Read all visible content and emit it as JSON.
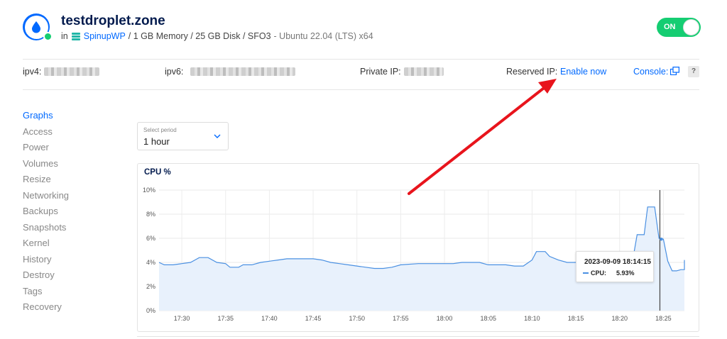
{
  "droplet": {
    "name": "testdroplet.zone",
    "subtitle_in": "in",
    "project": "SpinupWP",
    "specs": "/ 1 GB Memory / 25 GB Disk / SFO3",
    "image": "- Ubuntu 22.04 (LTS) x64",
    "power_toggle": "ON"
  },
  "ip_bar": {
    "ipv4_label": "ipv4:",
    "ipv6_label": "ipv6:",
    "private_label": "Private IP:",
    "reserved_label": "Reserved IP:",
    "reserved_link": "Enable now",
    "console_label": "Console:",
    "help": "?"
  },
  "sidebar": {
    "items": [
      {
        "label": "Graphs",
        "active": true
      },
      {
        "label": "Access"
      },
      {
        "label": "Power"
      },
      {
        "label": "Volumes"
      },
      {
        "label": "Resize"
      },
      {
        "label": "Networking"
      },
      {
        "label": "Backups"
      },
      {
        "label": "Snapshots"
      },
      {
        "label": "Kernel"
      },
      {
        "label": "History"
      },
      {
        "label": "Destroy"
      },
      {
        "label": "Tags"
      },
      {
        "label": "Recovery"
      }
    ]
  },
  "period": {
    "caption": "Select period",
    "value": "1 hour"
  },
  "colors": {
    "accent": "#0069ff",
    "on_green": "#15cd72",
    "series_line": "#4a90e2",
    "series_fill": "#e8f1fc",
    "annotation_arrow": "#e8141c"
  },
  "icons": {
    "droplet": "water-drop-icon",
    "project": "stack-icon",
    "console": "external-window-icon",
    "period": "chevron-down-icon"
  },
  "tooltip": {
    "date": "2023-09-09 18:14:15",
    "series": "CPU:",
    "value": "5.93%"
  },
  "chart_data": {
    "type": "area",
    "title": "CPU %",
    "ylim": [
      0,
      10
    ],
    "yticks": [
      "10%",
      "8%",
      "6%",
      "4%",
      "2%",
      "0%"
    ],
    "ytick_values": [
      10,
      8,
      6,
      4,
      2,
      0
    ],
    "xticks": [
      "17:30",
      "17:35",
      "17:40",
      "17:45",
      "17:50",
      "17:55",
      "18:00",
      "18:05",
      "18:10",
      "18:15",
      "18:20",
      "18:25"
    ],
    "xlim_minutes": [
      17.4,
      77.4
    ],
    "grid": true,
    "series": [
      {
        "values": [
          [
            17.4,
            4.0
          ],
          [
            18.0,
            3.8
          ],
          [
            19.0,
            3.8
          ],
          [
            20.0,
            3.9
          ],
          [
            21.0,
            4.0
          ],
          [
            21.5,
            4.2
          ],
          [
            22.0,
            4.4
          ],
          [
            23.0,
            4.4
          ],
          [
            24.0,
            4.0
          ],
          [
            25.0,
            3.9
          ],
          [
            25.5,
            3.6
          ],
          [
            26.5,
            3.6
          ],
          [
            27.0,
            3.8
          ],
          [
            28.0,
            3.8
          ],
          [
            29.0,
            4.0
          ],
          [
            30.0,
            4.1
          ],
          [
            31.0,
            4.2
          ],
          [
            32.0,
            4.3
          ],
          [
            35.0,
            4.3
          ],
          [
            36.0,
            4.2
          ],
          [
            37.0,
            4.0
          ],
          [
            38.0,
            3.9
          ],
          [
            39.0,
            3.8
          ],
          [
            40.0,
            3.7
          ],
          [
            41.0,
            3.6
          ],
          [
            42.0,
            3.5
          ],
          [
            43.0,
            3.5
          ],
          [
            44.0,
            3.6
          ],
          [
            45.0,
            3.8
          ],
          [
            47.0,
            3.9
          ],
          [
            51.0,
            3.9
          ],
          [
            52.0,
            4.0
          ],
          [
            53.0,
            4.0
          ],
          [
            54.0,
            4.0
          ],
          [
            55.0,
            3.8
          ],
          [
            57.0,
            3.8
          ],
          [
            58.0,
            3.7
          ],
          [
            59.0,
            3.7
          ],
          [
            60.0,
            4.2
          ],
          [
            60.5,
            4.9
          ],
          [
            61.5,
            4.9
          ],
          [
            62.0,
            4.5
          ],
          [
            63.0,
            4.2
          ],
          [
            64.0,
            4.0
          ],
          [
            67.0,
            4.0
          ],
          [
            68.0,
            3.8
          ],
          [
            69.0,
            3.8
          ],
          [
            70.0,
            3.9
          ],
          [
            70.5,
            4.2
          ],
          [
            71.5,
            4.2
          ],
          [
            72.0,
            6.3
          ],
          [
            72.8,
            6.3
          ],
          [
            73.2,
            8.6
          ],
          [
            74.0,
            8.6
          ],
          [
            74.5,
            6.0
          ],
          [
            75.0,
            5.93
          ],
          [
            75.5,
            4.1
          ],
          [
            76.0,
            3.3
          ],
          [
            76.5,
            3.3
          ],
          [
            77.0,
            3.4
          ],
          [
            77.4,
            3.4
          ]
        ],
        "tail": [
          [
            82.0,
            3.8
          ],
          [
            85.0,
            4.0
          ],
          [
            87.0,
            4.2
          ],
          [
            88.0,
            4.2
          ],
          [
            89.0,
            4.0
          ]
        ]
      }
    ],
    "cursor_minute": 74.6
  }
}
